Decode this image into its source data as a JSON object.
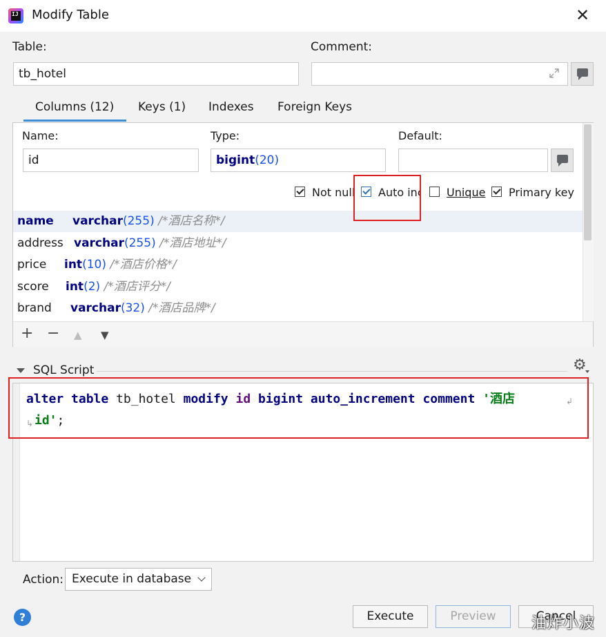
{
  "window": {
    "title": "Modify Table",
    "close_glyph": "✕"
  },
  "table": {
    "label": "Table:",
    "value": "tb_hotel"
  },
  "comment": {
    "label": "Comment:",
    "value": ""
  },
  "tabs": [
    {
      "label": "Columns (12)",
      "active": true
    },
    {
      "label": "Keys (1)",
      "active": false
    },
    {
      "label": "Indexes",
      "active": false
    },
    {
      "label": "Foreign Keys",
      "active": false
    }
  ],
  "column_editor": {
    "name_label": "Name:",
    "name_value": "id",
    "type_label": "Type:",
    "type_kw": "bigint",
    "type_num": "(20)",
    "default_label": "Default:",
    "default_value": "",
    "checkboxes": [
      {
        "label": "Not null",
        "checked": true
      },
      {
        "label": "Auto inc",
        "checked": true
      },
      {
        "label": "Unique",
        "checked": false
      },
      {
        "label": "Primary key",
        "checked": true
      }
    ]
  },
  "columns": [
    {
      "name": "name",
      "type": "varchar",
      "size": "(255)",
      "comment": "/*酒店名称*/",
      "selected": true
    },
    {
      "name": "address",
      "type": "varchar",
      "size": "(255)",
      "comment": "/*酒店地址*/",
      "selected": false
    },
    {
      "name": "price",
      "type": "int",
      "size": "(10)",
      "comment": "/*酒店价格*/",
      "selected": false
    },
    {
      "name": "score",
      "type": "int",
      "size": "(2)",
      "comment": "/*酒店评分*/",
      "selected": false
    },
    {
      "name": "brand",
      "type": "varchar",
      "size": "(32)",
      "comment": "/*酒店品牌*/",
      "selected": false
    }
  ],
  "toolbar": {
    "add": "+",
    "remove": "−",
    "up": "▲",
    "down": "▼"
  },
  "sql": {
    "header": "SQL Script",
    "line1": [
      "alter",
      "table",
      "tb_hotel",
      "modify",
      "id",
      "bigint",
      "auto_increment",
      "comment",
      "'酒店"
    ],
    "line2": [
      "id'",
      ";"
    ]
  },
  "action": {
    "label": "Action:",
    "selected": "Execute in database"
  },
  "buttons": {
    "execute": "Execute",
    "preview": "Preview",
    "cancel": "Cancel"
  },
  "watermark": "油炸小波",
  "colors": {
    "accent": "#3d8ed6",
    "highlight_box": "#e02020",
    "keyword": "#000080",
    "string": "#067d17"
  }
}
